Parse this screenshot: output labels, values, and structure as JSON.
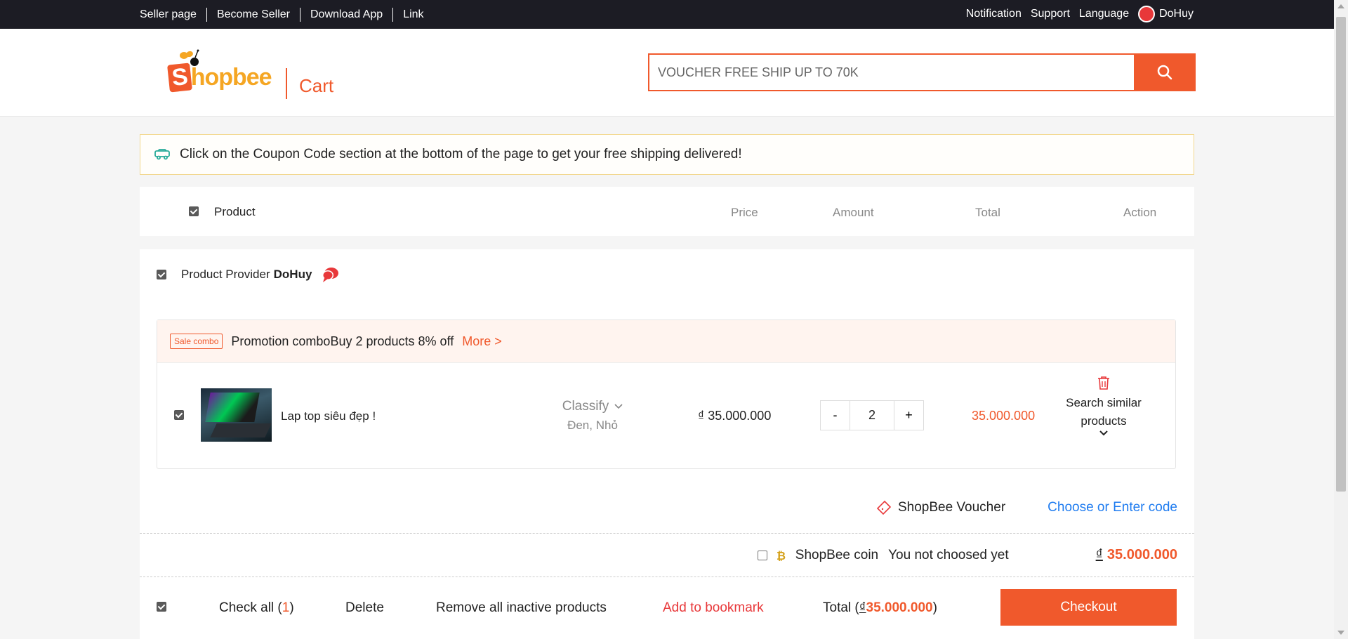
{
  "topbar": {
    "links": [
      "Seller page",
      "Become Seller",
      "Download App",
      "Link"
    ],
    "notification": "Notification",
    "support": "Support",
    "language": "Language",
    "username": "DoHuy"
  },
  "header": {
    "logo_first": "S",
    "logo_rest": "hopbee",
    "page_title": "Cart",
    "search_placeholder": "VOUCHER FREE SHIP UP TO 70K"
  },
  "notice": {
    "text": "Click on the Coupon Code section at the bottom of the page to get your free shipping delivered!"
  },
  "table_header": {
    "product": "Product",
    "price": "Price",
    "amount": "Amount",
    "total": "Total",
    "action": "Action"
  },
  "shop": {
    "provider_label": "Product Provider",
    "provider_name": "DoHuy",
    "promo": {
      "tag": "Sale combo",
      "text": "Promotion comboBuy 2 products 8% off",
      "more": "More >"
    },
    "items": [
      {
        "name": "Lap top siêu đẹp !",
        "classify_label": "Classify",
        "classify_value": "Đen, Nhỏ",
        "price": "₫ 35.000.000",
        "quantity": "2",
        "total": "35.000.000",
        "action_label": "Search similar products",
        "checked": true
      }
    ],
    "voucher_label": "ShopBee Voucher",
    "voucher_action": "Choose or Enter code",
    "coin_label": "ShopBee coin",
    "coin_status": "You not choosed yet",
    "coin_currency": "₫",
    "coin_amount": "35.000.000"
  },
  "footer": {
    "check_all": "Check all",
    "check_all_count": "1",
    "delete": "Delete",
    "remove_inactive": "Remove all inactive products",
    "add_bookmark": "Add to bookmark",
    "total_label": "Total",
    "total_currency": "₫",
    "total_amount": "35.000.000",
    "checkout": "Checkout"
  },
  "colors": {
    "accent": "#f0592c",
    "link": "#1f7cf0",
    "topbar": "#1c1c24"
  }
}
